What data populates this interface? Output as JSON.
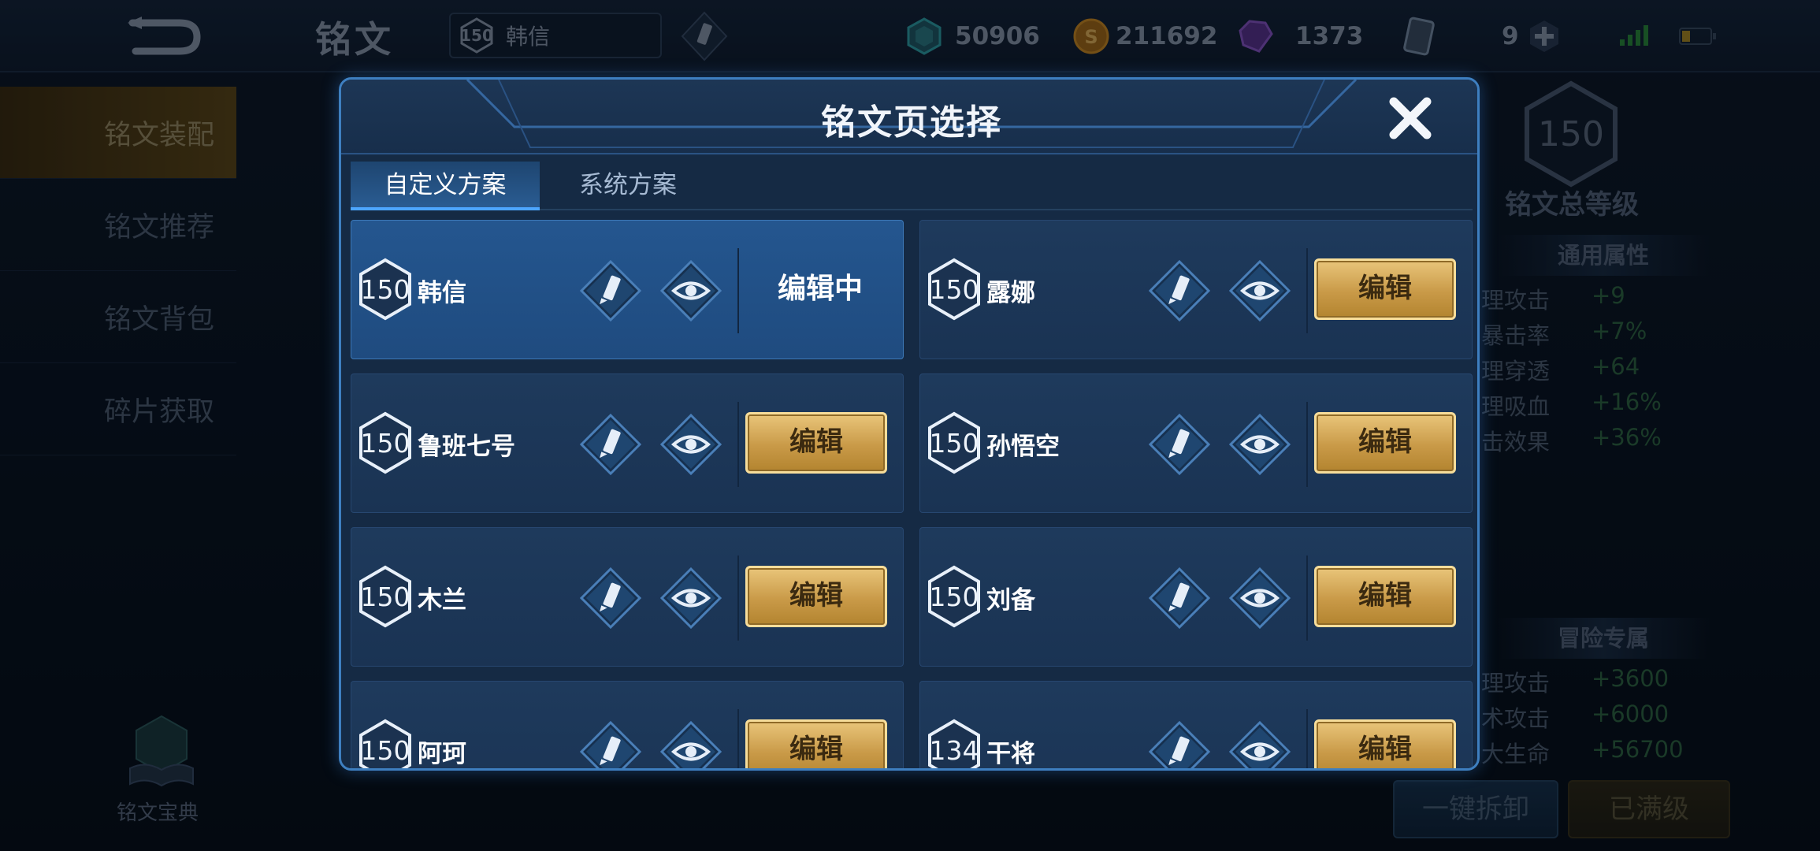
{
  "topbar": {
    "back_icon": "back-arrow-icon",
    "title": "铭文",
    "hero_level": "150",
    "hero_name": "韩信",
    "resources": [
      {
        "name": "diamond",
        "icon": "cube-gem-icon",
        "value": "50906",
        "color": "#2fa0a8"
      },
      {
        "name": "gold",
        "icon": "gold-coin-icon",
        "value": "211692",
        "color": "#d08a1f"
      },
      {
        "name": "crystal",
        "icon": "purple-crystal-icon",
        "value": "1373",
        "color": "#8a55c8"
      },
      {
        "name": "card",
        "icon": "card-icon",
        "value": "9",
        "color": "#7a8ea8"
      }
    ]
  },
  "sidebar": {
    "items": [
      {
        "label": "铭文装配",
        "active": true
      },
      {
        "label": "铭文推荐",
        "active": false
      },
      {
        "label": "铭文背包",
        "active": false
      },
      {
        "label": "碎片获取",
        "active": false
      }
    ],
    "codex_label": "铭文宝典"
  },
  "right_panel": {
    "total_level": "150",
    "title": "铭文总等级",
    "general_header": "通用属性",
    "general_attrs": [
      {
        "name": "理攻击",
        "value": "+9"
      },
      {
        "name": "暴击率",
        "value": "+7%"
      },
      {
        "name": "理穿透",
        "value": "+64"
      },
      {
        "name": "理吸血",
        "value": "+16%"
      },
      {
        "name": "击效果",
        "value": "+36%"
      }
    ],
    "adventure_header": "冒险专属",
    "adventure_attrs": [
      {
        "name": "理攻击",
        "value": "+3600"
      },
      {
        "name": "术攻击",
        "value": "+6000"
      },
      {
        "name": "大生命",
        "value": "+56700"
      }
    ],
    "unload_button": "一键拆卸",
    "maxed_button": "已满级"
  },
  "modal": {
    "title": "铭文页选择",
    "close_icon": "close-x-icon",
    "tabs": [
      {
        "label": "自定义方案",
        "active": true
      },
      {
        "label": "系统方案",
        "active": false
      }
    ],
    "edit_label": "编辑",
    "editing_label": "编辑中",
    "cards": [
      {
        "level": "150",
        "name": "韩信",
        "current": true
      },
      {
        "level": "150",
        "name": "露娜",
        "current": false
      },
      {
        "level": "150",
        "name": "鲁班七号",
        "current": false
      },
      {
        "level": "150",
        "name": "孙悟空",
        "current": false
      },
      {
        "level": "150",
        "name": "木兰",
        "current": false
      },
      {
        "level": "150",
        "name": "刘备",
        "current": false
      },
      {
        "level": "150",
        "name": "阿珂",
        "current": false
      },
      {
        "level": "134",
        "name": "干将",
        "current": false
      }
    ]
  }
}
